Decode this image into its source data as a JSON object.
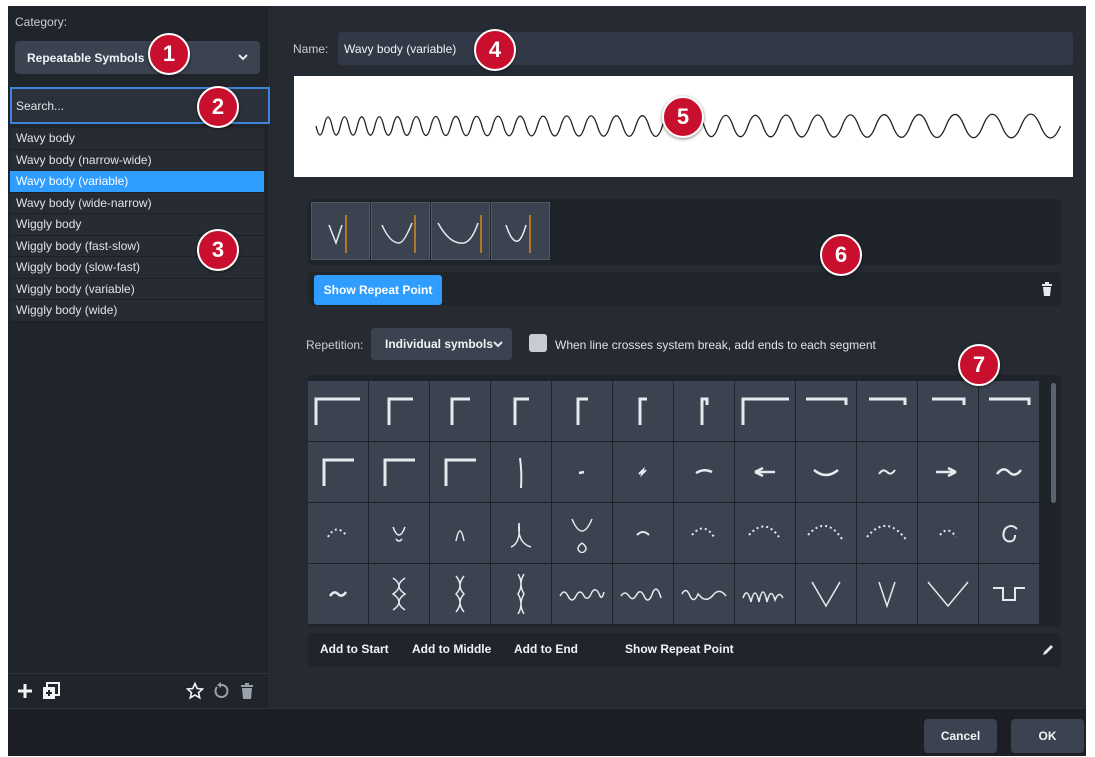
{
  "left": {
    "category_label": "Category:",
    "category_value": "Repeatable Symbols",
    "search_placeholder": "Search...",
    "items": [
      {
        "label": "Wavy body"
      },
      {
        "label": "Wavy body (narrow-wide)"
      },
      {
        "label": "Wavy body (variable)"
      },
      {
        "label": "Wavy body (wide-narrow)"
      },
      {
        "label": "Wiggly body"
      },
      {
        "label": "Wiggly body (fast-slow)"
      },
      {
        "label": "Wiggly body (slow-fast)"
      },
      {
        "label": "Wiggly body (variable)"
      },
      {
        "label": "Wiggly body (wide)"
      }
    ],
    "selected_item": "Wavy body (variable)",
    "footer_icons": [
      "add-icon",
      "duplicate-icon",
      "star-icon",
      "reset-icon",
      "trash-icon"
    ]
  },
  "right": {
    "name_label": "Name:",
    "name_value": "Wavy body (variable)",
    "components_bar": {
      "show_repeat_point": "Show Repeat Point"
    },
    "repetition_label": "Repetition:",
    "repetition_value": "Individual symbols",
    "system_break_label": "When line crosses system break, add ends to each segment",
    "system_break_checked": false,
    "grid_bar": {
      "add_to_start": "Add to Start",
      "add_to_middle": "Add to Middle",
      "add_to_end": "Add to End",
      "show_repeat_point": "Show Repeat Point"
    }
  },
  "footer": {
    "cancel": "Cancel",
    "ok": "OK"
  },
  "callouts": [
    "1",
    "2",
    "3",
    "4",
    "5",
    "6",
    "7"
  ],
  "colors": {
    "accent": "#2f9cff",
    "callout": "#c8102e",
    "panel": "#262b33"
  }
}
